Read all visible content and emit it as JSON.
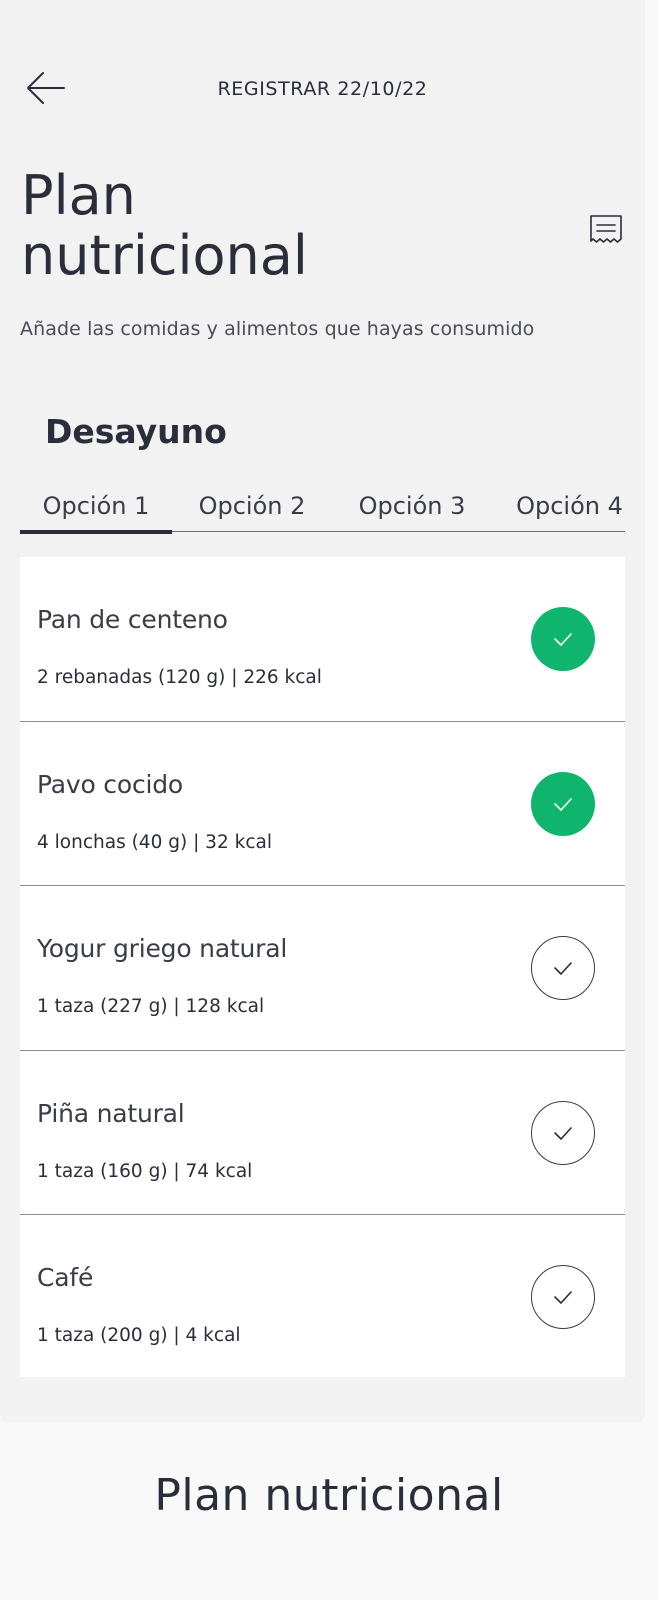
{
  "header": {
    "back_icon": "arrow-left-icon",
    "title": "REGISTRAR 22/10/22"
  },
  "page": {
    "title_line1": "Plan",
    "title_line2": "nutricional",
    "notes_icon": "receipt-icon",
    "subtitle": "Añade las comidas y alimentos que hayas consumido"
  },
  "meal": {
    "title": "Desayuno",
    "tabs": [
      {
        "label": "Opción 1",
        "active": true
      },
      {
        "label": "Opción 2",
        "active": false
      },
      {
        "label": "Opción 3",
        "active": false
      },
      {
        "label": "Opción 4",
        "active": false
      }
    ],
    "items": [
      {
        "name": "Pan de centeno",
        "detail": "2 rebanadas (120 g) | 226 kcal",
        "checked": true
      },
      {
        "name": "Pavo cocido",
        "detail": "4 lonchas (40 g) | 32 kcal",
        "checked": true
      },
      {
        "name": "Yogur griego natural",
        "detail": "1 taza (227 g) | 128 kcal",
        "checked": false
      },
      {
        "name": "Piña natural",
        "detail": "1 taza (160 g) | 74 kcal",
        "checked": false
      },
      {
        "name": "Café",
        "detail": "1 taza (200 g) | 4 kcal",
        "checked": false
      }
    ]
  },
  "colors": {
    "accent_green": "#10b56d",
    "text_dark": "#2b2d3a",
    "screen_bg": "#f2f2f2"
  },
  "caption": "Plan nutricional"
}
